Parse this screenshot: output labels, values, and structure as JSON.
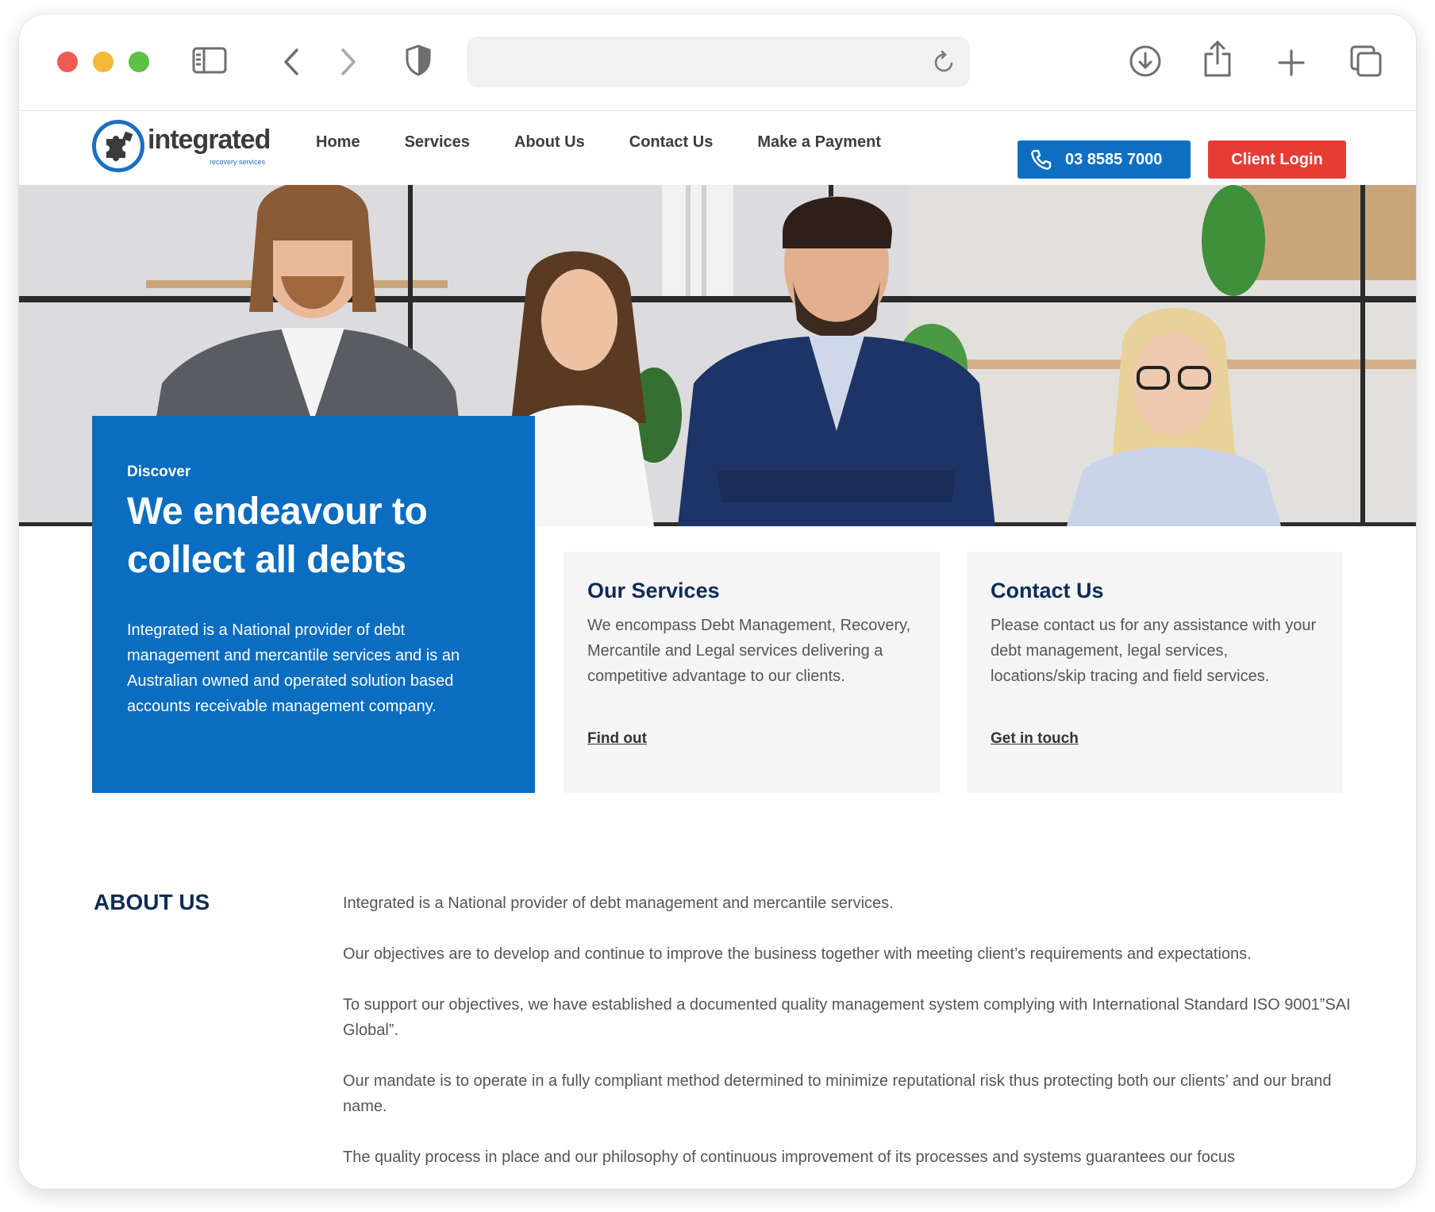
{
  "nav": {
    "items": [
      "Home",
      "Services",
      "About Us",
      "Contact Us",
      "Make a Payment"
    ]
  },
  "header": {
    "logo_text": "integrated",
    "logo_sub": "recovery services",
    "phone": "03 8585 7000",
    "login_label": "Client Login"
  },
  "hero": {
    "eyebrow": "Discover",
    "title": "We endeavour to collect all debts",
    "body": "Integrated is a National provider of debt management and mercantile services and is an Australian owned and operated solution based accounts receivable management company."
  },
  "cards": [
    {
      "title": "Our Services",
      "body": "We encompass Debt Management, Recovery, Mercantile and Legal services delivering a competitive advantage to our clients.",
      "link": "Find out"
    },
    {
      "title": "Contact Us",
      "body": "Please contact us for any assistance with your debt management, legal services, locations/skip tracing and field services.",
      "link": "Get in touch"
    }
  ],
  "about": {
    "title": "ABOUT US",
    "paragraphs": [
      "Integrated is a National provider of debt management and mercantile services.",
      "Our objectives are to develop and continue to improve the business together with meeting client’s requirements and expectations.",
      "To support our objectives, we have established a documented quality management system complying with International Standard ISO 9001”SAI Global”.",
      "Our mandate is to operate in a fully compliant method determined to minimize reputational risk thus protecting both our clients’ and our brand name.",
      "The quality process in place and our philosophy of continuous improvement of its processes and systems guarantees our focus"
    ]
  },
  "colors": {
    "brand_blue": "#0a6dc0",
    "login_red": "#e73c34",
    "navy": "#0d2c55"
  },
  "icons": {
    "sidebar": "sidebar-icon",
    "back": "chevron-left-icon",
    "forward": "chevron-right-icon",
    "privacy": "shield-icon",
    "reload": "reload-icon",
    "download": "download-icon",
    "share": "share-icon",
    "new_tab": "plus-icon",
    "tabs": "tabs-icon",
    "phone": "phone-icon"
  }
}
